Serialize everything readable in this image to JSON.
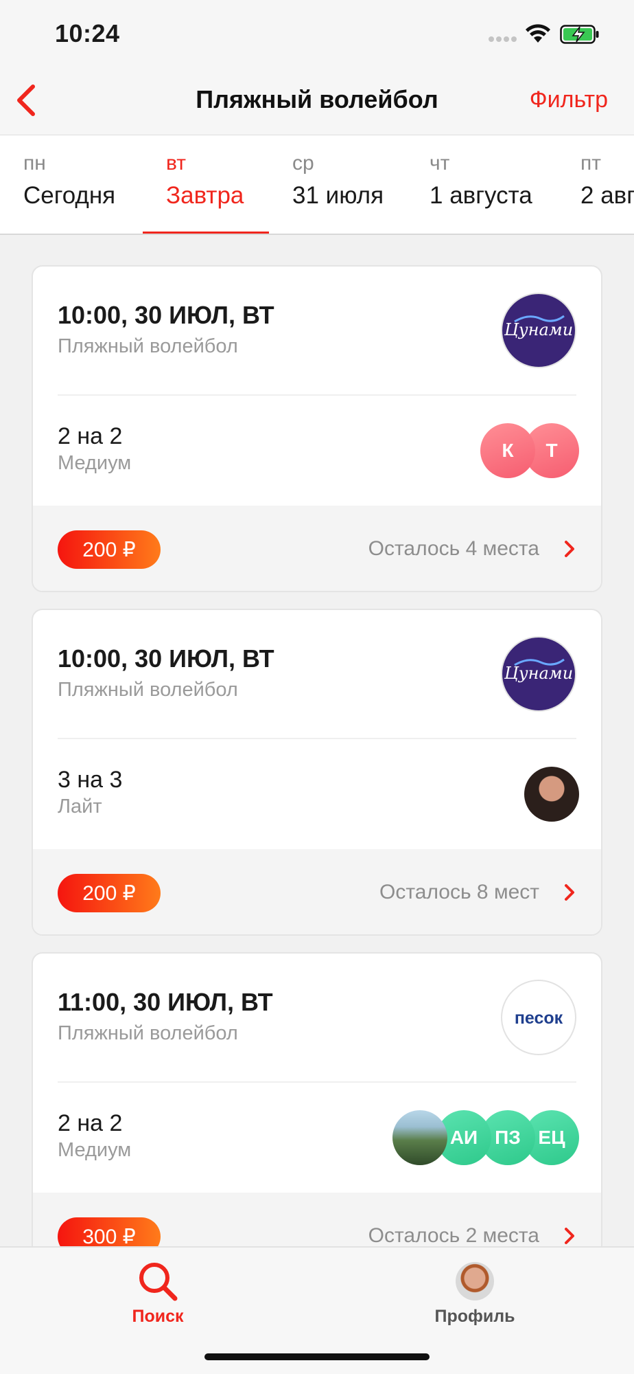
{
  "status_bar": {
    "time": "10:24"
  },
  "nav": {
    "title": "Пляжный волейбол",
    "filter_label": "Фильтр"
  },
  "day_tabs": [
    {
      "dow": "пн",
      "date": "Сегодня"
    },
    {
      "dow": "вт",
      "date": "Завтра",
      "active": true
    },
    {
      "dow": "ср",
      "date": "31 июля"
    },
    {
      "dow": "чт",
      "date": "1 августа"
    },
    {
      "dow": "пт",
      "date": "2 авг"
    }
  ],
  "games": [
    {
      "when": "10:00, 30 ИЮЛ, ВТ",
      "sport": "Пляжный волейбол",
      "venue_logo": "Цунами",
      "format": "2 на 2",
      "level": "Медиум",
      "players": [
        "К",
        "Т"
      ],
      "price": "200 ₽",
      "seats_left": "Осталось 4 места"
    },
    {
      "when": "10:00, 30 ИЮЛ, ВТ",
      "sport": "Пляжный волейбол",
      "venue_logo": "Цунами",
      "format": "3 на 3",
      "level": "Лайт",
      "players": [],
      "price": "200 ₽",
      "seats_left": "Осталось 8 мест"
    },
    {
      "when": "11:00, 30 ИЮЛ, ВТ",
      "sport": "Пляжный волейбол",
      "venue_logo": "песок",
      "format": "2 на 2",
      "level": "Медиум",
      "players": [
        "АИ",
        "ПЗ",
        "ЕЦ"
      ],
      "price": "300 ₽",
      "seats_left": "Осталось 2 места"
    }
  ],
  "tab_bar": {
    "search_label": "Поиск",
    "profile_label": "Профиль"
  },
  "colors": {
    "accent": "#f0261d",
    "price_gradient_start": "#f5150f",
    "price_gradient_end": "#ff7b1a"
  }
}
